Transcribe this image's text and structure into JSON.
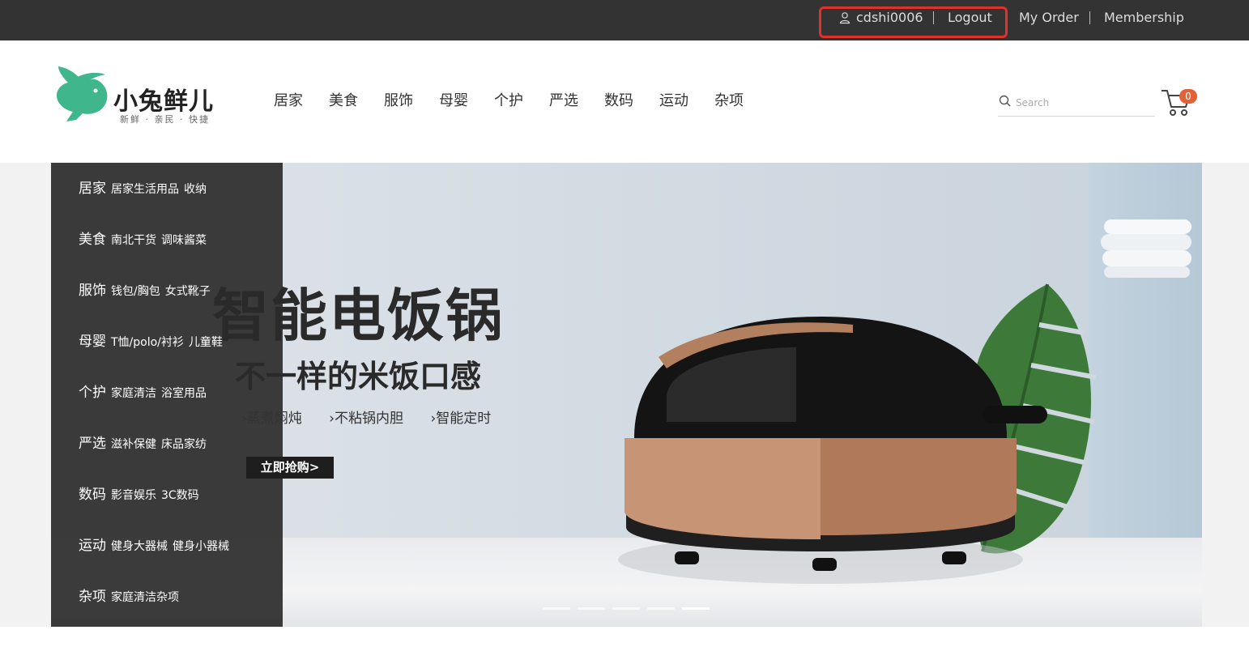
{
  "topbar": {
    "username": "cdshi0006",
    "logout": "Logout",
    "my_order": "My Order",
    "membership": "Membership",
    "highlight_color": "#e0322a"
  },
  "logo": {
    "name": "小兔鲜儿",
    "tagline": "新鲜 · 亲民 · 快捷",
    "brand_color": "#3fb68b"
  },
  "nav": {
    "items": [
      "居家",
      "美食",
      "服饰",
      "母婴",
      "个护",
      "严选",
      "数码",
      "运动",
      "杂项"
    ]
  },
  "search": {
    "placeholder": "Search"
  },
  "cart": {
    "count": "0",
    "badge_color": "#e26237"
  },
  "categories": [
    {
      "name": "居家",
      "subs": [
        "居家生活用品",
        "收纳"
      ]
    },
    {
      "name": "美食",
      "subs": [
        "南北干货",
        "调味酱菜"
      ]
    },
    {
      "name": "服饰",
      "subs": [
        "钱包/胸包",
        "女式靴子"
      ]
    },
    {
      "name": "母婴",
      "subs": [
        "T恤/polo/衬衫",
        "儿童鞋"
      ]
    },
    {
      "name": "个护",
      "subs": [
        "家庭清洁",
        "浴室用品"
      ]
    },
    {
      "name": "严选",
      "subs": [
        "滋补保健",
        "床品家纺"
      ]
    },
    {
      "name": "数码",
      "subs": [
        "影音娱乐",
        "3C数码"
      ]
    },
    {
      "name": "运动",
      "subs": [
        "健身大器械",
        "健身小器械"
      ]
    },
    {
      "name": "杂项",
      "subs": [
        "家庭清洁杂项"
      ]
    }
  ],
  "banner": {
    "headline": "智能电饭锅",
    "subline": "不一样的米饭口感",
    "features": [
      "蒸煮焖炖",
      "不粘锅内胆",
      "智能定时"
    ],
    "cta": "立即抢购>",
    "slides": 5,
    "active_slide": 5
  }
}
